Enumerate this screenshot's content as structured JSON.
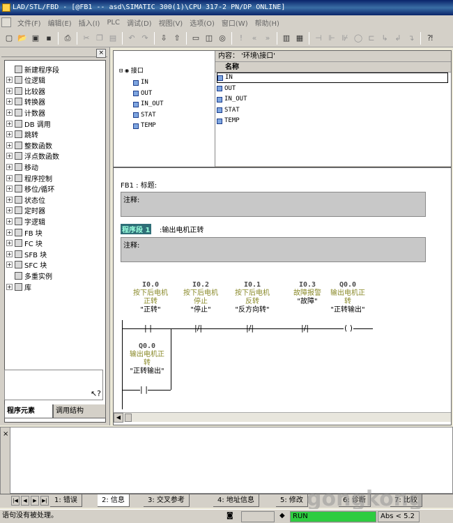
{
  "window": {
    "title": "LAD/STL/FBD  - [@FB1 -- asd\\SIMATIC 300(1)\\CPU 317-2 PN/DP  ONLINE]"
  },
  "menu": [
    "文件(F)",
    "编辑(E)",
    "插入(I)",
    "PLC",
    "调试(D)",
    "视图(V)",
    "选项(O)",
    "窗口(W)",
    "帮助(H)"
  ],
  "left": {
    "tree": [
      {
        "label": "新建程序段",
        "icon": "new-network-icon",
        "expand": ""
      },
      {
        "label": "位逻辑",
        "icon": "bit-logic-icon",
        "expand": "+"
      },
      {
        "label": "比较器",
        "icon": "comparator-icon",
        "expand": "+"
      },
      {
        "label": "转换器",
        "icon": "converter-icon",
        "expand": "+"
      },
      {
        "label": "计数器",
        "icon": "counter-icon",
        "expand": "+"
      },
      {
        "label": "DB 调用",
        "icon": "db-call-icon",
        "expand": "+"
      },
      {
        "label": "跳转",
        "icon": "jump-icon",
        "expand": "+"
      },
      {
        "label": "整数函数",
        "icon": "integer-function-icon",
        "expand": "+"
      },
      {
        "label": "浮点数函数",
        "icon": "float-function-icon",
        "expand": "+"
      },
      {
        "label": "移动",
        "icon": "move-icon",
        "expand": "+"
      },
      {
        "label": "程序控制",
        "icon": "program-control-icon",
        "expand": "+"
      },
      {
        "label": "移位/循环",
        "icon": "shift-rotate-icon",
        "expand": "+"
      },
      {
        "label": "状态位",
        "icon": "status-bit-icon",
        "expand": "+"
      },
      {
        "label": "定时器",
        "icon": "timer-icon",
        "expand": "+"
      },
      {
        "label": "字逻辑",
        "icon": "word-logic-icon",
        "expand": "+"
      },
      {
        "label": "FB 块",
        "icon": "fb-block-icon",
        "expand": "+"
      },
      {
        "label": "FC 块",
        "icon": "fc-block-icon",
        "expand": "+"
      },
      {
        "label": "SFB 块",
        "icon": "sfb-block-icon",
        "expand": "+"
      },
      {
        "label": "SFC 块",
        "icon": "sfc-block-icon",
        "expand": "+"
      },
      {
        "label": "多重实例",
        "icon": "multi-instance-icon",
        "expand": ""
      },
      {
        "label": "库",
        "icon": "library-icon",
        "expand": "+"
      }
    ],
    "tabs": [
      "程序元素",
      "调用结构"
    ]
  },
  "interface": {
    "content_label": "内容：  '环境\\接口'",
    "root": "接口",
    "items": [
      "IN",
      "OUT",
      "IN_OUT",
      "STAT",
      "TEMP"
    ],
    "column_name": "名称"
  },
  "code": {
    "block_title": "FB1 : 标题:",
    "comment_label": "注释:",
    "network_label": "程序段 1",
    "network_title": ":输出电机正转",
    "contacts": [
      {
        "addr": "I0.0",
        "name1": "按下后电机",
        "name2": "正转",
        "symbol": "\"正转\"",
        "type": "NO"
      },
      {
        "addr": "I0.2",
        "name1": "按下后电机",
        "name2": "停止",
        "symbol": "\"停止\"",
        "type": "NC"
      },
      {
        "addr": "I0.1",
        "name1": "按下后电机",
        "name2": "反转",
        "symbol": "\"反方向转\"",
        "type": "NC"
      },
      {
        "addr": "I0.3",
        "name1": "故障报警",
        "name2": "",
        "symbol": "\"故障\"",
        "type": "NC"
      }
    ],
    "coil": {
      "addr": "Q0.0",
      "name1": "输出电机正",
      "name2": "转",
      "symbol": "\"正转输出\""
    },
    "branch": {
      "addr": "Q0.0",
      "name1": "输出电机正",
      "name2": "转",
      "symbol": "\"正转输出\""
    }
  },
  "messages": {
    "tabs": [
      "1: 错误",
      "2: 信息",
      "3: 交叉参考",
      "4: 地址信息",
      "5: 修改",
      "6: 诊断",
      "7: 比较"
    ]
  },
  "status": {
    "text": "语句没有被处理。",
    "run": "RUN",
    "abs": "Abs < 5.2"
  },
  "watermark": "gongkong"
}
